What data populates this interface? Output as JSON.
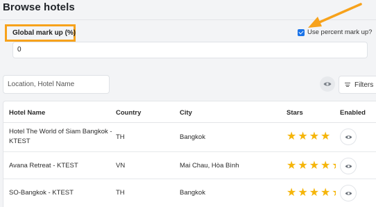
{
  "page": {
    "title": "Browse hotels"
  },
  "markup": {
    "label": "Global mark up (%)",
    "value": "0",
    "use_percent_label": "Use percent mark up?",
    "use_percent_checked": true
  },
  "filters_bar": {
    "search_placeholder": "Location, Hotel Name",
    "filters_label": "Filters"
  },
  "table": {
    "headers": [
      "Hotel Name",
      "Country",
      "City",
      "Stars",
      "Enabled"
    ],
    "rows": [
      {
        "name_line1": "Hotel The World of Siam Bangkok -",
        "name_line2": "KTEST",
        "country": "TH",
        "city": "Bangkok",
        "stars": 4
      },
      {
        "name_line1": "Avana Retreat - KTEST",
        "name_line2": "",
        "country": "VN",
        "city": "Mai Chau, Hòa Bình",
        "stars": 4.5
      },
      {
        "name_line1": "SO-Bangkok - KTEST",
        "name_line2": "",
        "country": "TH",
        "city": "Bangkok",
        "stars": 4.5
      }
    ]
  },
  "colors": {
    "highlight": "#f7a21b",
    "star": "#f5b50a",
    "checkbox": "#1a73e8"
  },
  "icons": [
    "eye-icon",
    "filter-lines-icon",
    "checkbox-checked-icon",
    "star-icon",
    "arrow-annotation"
  ]
}
